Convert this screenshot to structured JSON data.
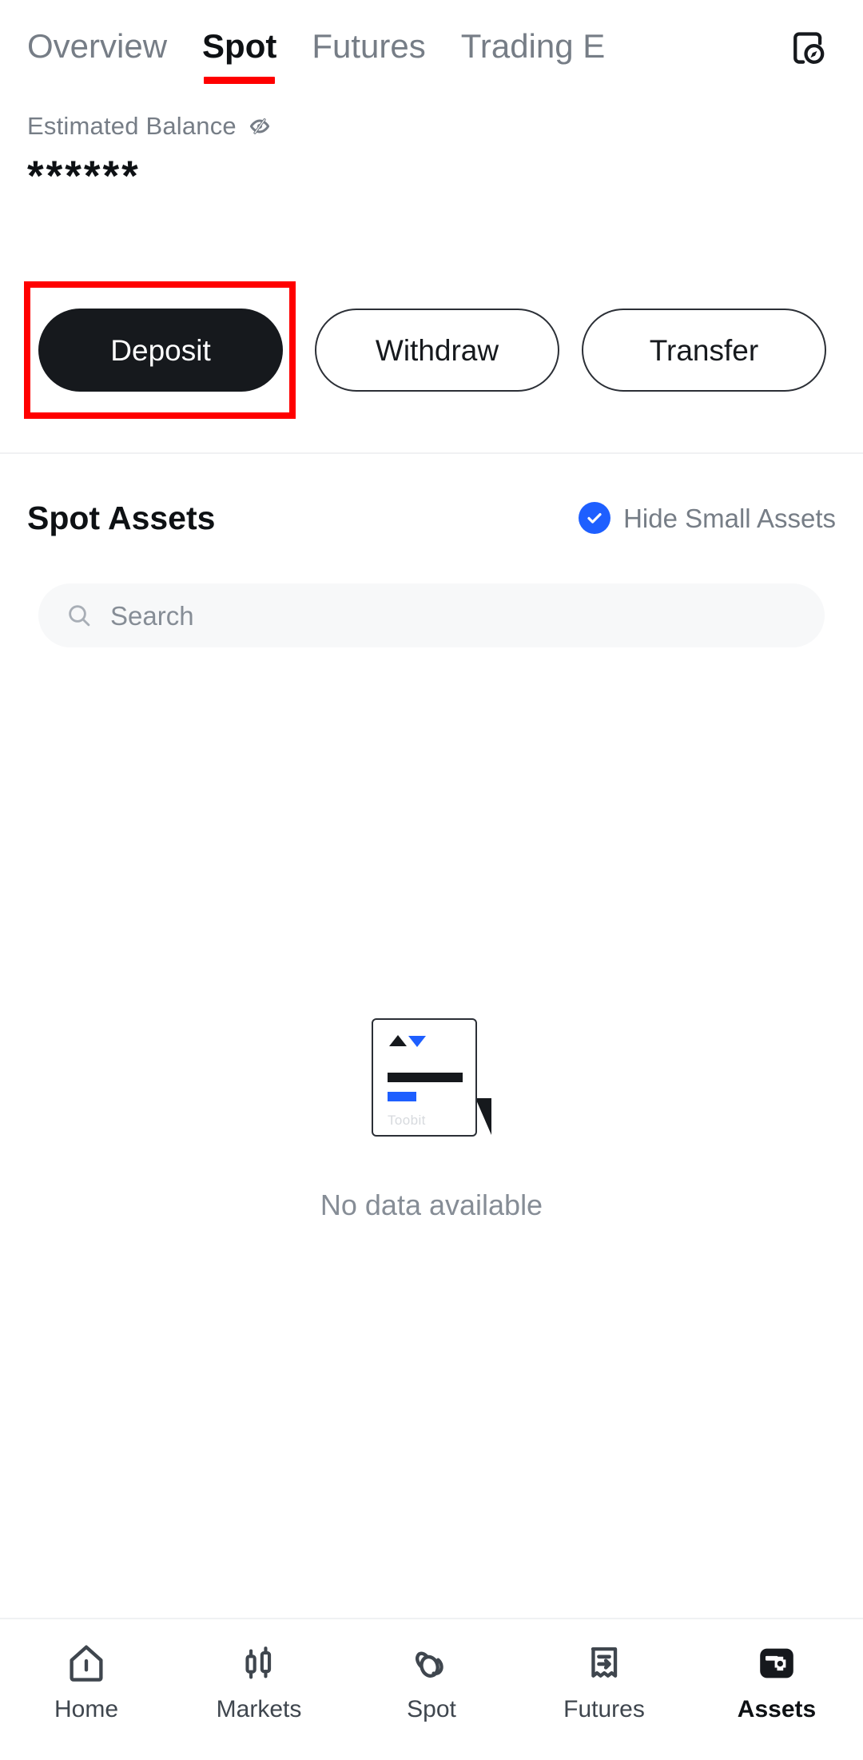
{
  "top_tabs": {
    "items": [
      {
        "label": "Overview",
        "active": false
      },
      {
        "label": "Spot",
        "active": true
      },
      {
        "label": "Futures",
        "active": false
      },
      {
        "label": "Trading E",
        "active": false
      }
    ],
    "history_icon": "order-history-icon",
    "active_underline_color": "#ff0000"
  },
  "balance": {
    "label": "Estimated Balance",
    "visibility_icon": "eye-off-icon",
    "value": "******"
  },
  "actions": {
    "deposit_label": "Deposit",
    "withdraw_label": "Withdraw",
    "transfer_label": "Transfer",
    "highlight_color": "#ff0000",
    "primary_color": "#16191d"
  },
  "assets_section": {
    "title": "Spot Assets",
    "hide_small_label": "Hide Small Assets",
    "hide_small_checked": true,
    "check_color": "#1e5fff",
    "check_icon": "check-icon"
  },
  "search": {
    "icon": "search-icon",
    "placeholder": "Search",
    "value": ""
  },
  "empty_state": {
    "illustration_brand": "Toobit",
    "message": "No data available",
    "accent_color": "#1e5fff"
  },
  "bottom_nav": {
    "items": [
      {
        "label": "Home",
        "icon": "home-icon",
        "active": false
      },
      {
        "label": "Markets",
        "icon": "candlestick-icon",
        "active": false
      },
      {
        "label": "Spot",
        "icon": "spot-swirl-icon",
        "active": false
      },
      {
        "label": "Futures",
        "icon": "receipt-arrow-icon",
        "active": false
      },
      {
        "label": "Assets",
        "icon": "wallet-icon",
        "active": true
      }
    ]
  }
}
